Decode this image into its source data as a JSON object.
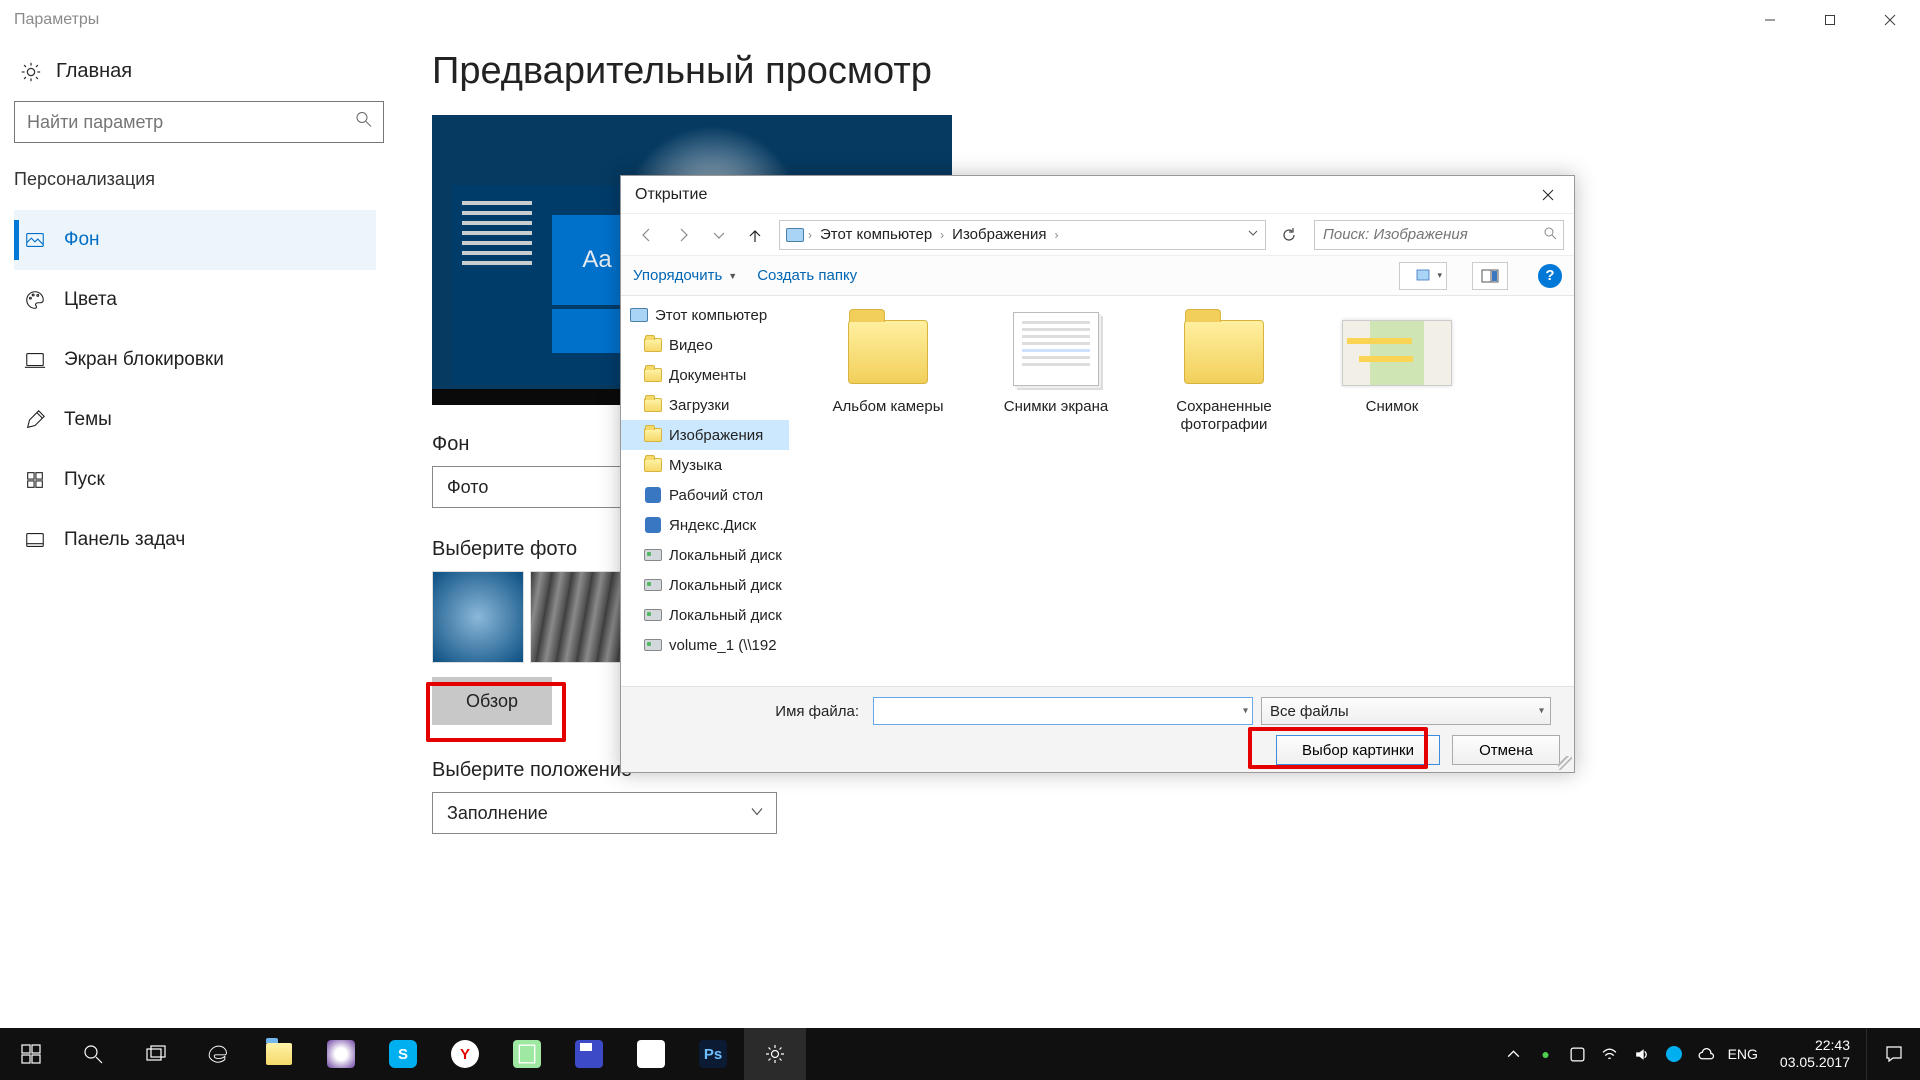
{
  "window": {
    "title": "Параметры"
  },
  "sidebar": {
    "home": "Главная",
    "search_placeholder": "Найти параметр",
    "section": "Персонализация",
    "items": [
      {
        "label": "Фон"
      },
      {
        "label": "Цвета"
      },
      {
        "label": "Экран блокировки"
      },
      {
        "label": "Темы"
      },
      {
        "label": "Пуск"
      },
      {
        "label": "Панель задач"
      }
    ]
  },
  "content": {
    "heading": "Предварительный просмотр",
    "preview_sample": "Aa",
    "bg_label": "Фон",
    "bg_value": "Фото",
    "choose_label": "Выберите фото",
    "browse": "Обзор",
    "fit_label": "Выберите положение",
    "fit_value": "Заполнение"
  },
  "dialog": {
    "title": "Открытие",
    "breadcrumb": {
      "root": "Этот компьютер",
      "leaf": "Изображения"
    },
    "search_placeholder": "Поиск: Изображения",
    "organize": "Упорядочить",
    "new_folder": "Создать папку",
    "tree": [
      {
        "label": "Этот компьютер",
        "kind": "monitor",
        "root": true
      },
      {
        "label": "Видео",
        "kind": "folder"
      },
      {
        "label": "Документы",
        "kind": "folder"
      },
      {
        "label": "Загрузки",
        "kind": "folder"
      },
      {
        "label": "Изображения",
        "kind": "folder",
        "selected": true
      },
      {
        "label": "Музыка",
        "kind": "folder"
      },
      {
        "label": "Рабочий стол",
        "kind": "blue"
      },
      {
        "label": "Яндекс.Диск",
        "kind": "blue"
      },
      {
        "label": "Локальный диск",
        "kind": "drive"
      },
      {
        "label": "Локальный диск",
        "kind": "drive"
      },
      {
        "label": "Локальный диск",
        "kind": "drive"
      },
      {
        "label": "volume_1 (\\\\192",
        "kind": "drive"
      }
    ],
    "files": [
      {
        "label": "Альбом камеры",
        "kind": "folder"
      },
      {
        "label": "Снимки экрана",
        "kind": "paper"
      },
      {
        "label": "Сохраненные фотографии",
        "kind": "folder"
      },
      {
        "label": "Снимок",
        "kind": "map"
      }
    ],
    "filename_label": "Имя файла:",
    "filename_value": "",
    "filetype": "Все файлы",
    "select_btn": "Выбор картинки",
    "cancel_btn": "Отмена"
  },
  "taskbar": {
    "lang": "ENG",
    "time": "22:43",
    "date": "03.05.2017"
  }
}
